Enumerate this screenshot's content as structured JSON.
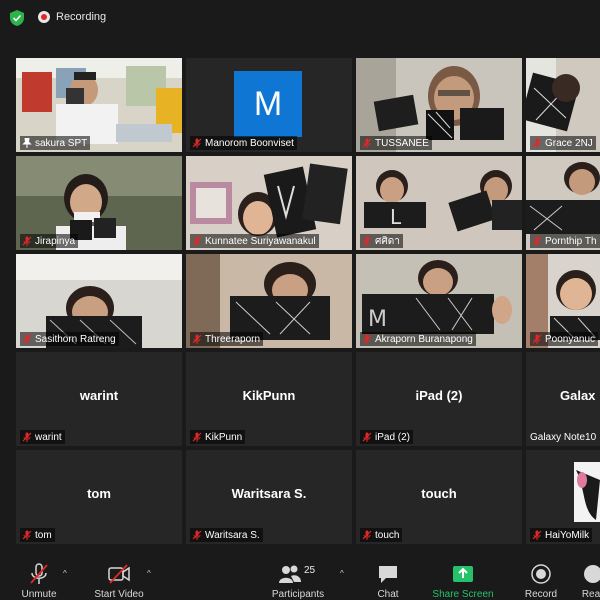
{
  "top": {
    "recording_label": "Recording"
  },
  "tiles": [
    {
      "name": "sakura SPT",
      "type": "video"
    },
    {
      "name": "Manorom Boonviset",
      "type": "avatar",
      "initial": "M"
    },
    {
      "name": "TUSSANEE",
      "type": "video"
    },
    {
      "name": "Grace 2NJ",
      "type": "video"
    },
    {
      "name": "Jirapinya",
      "type": "video"
    },
    {
      "name": "Kunnatee Suriyawanakul",
      "type": "video"
    },
    {
      "name": "ศศิดา",
      "type": "video"
    },
    {
      "name": "Pornthip Th",
      "type": "video"
    },
    {
      "name": "Sasithorn Ratreng",
      "type": "video"
    },
    {
      "name": "Threeraporn",
      "type": "video"
    },
    {
      "name": "Akraporn Buranapong",
      "type": "video"
    },
    {
      "name": "Poonyanuc",
      "type": "video"
    },
    {
      "name": "warint",
      "display": "warint",
      "type": "name"
    },
    {
      "name": "KikPunn",
      "display": "KikPunn",
      "type": "name"
    },
    {
      "name": "iPad (2)",
      "display": "iPad (2)",
      "type": "name"
    },
    {
      "name": "Galaxy Note10",
      "display": "Galax",
      "type": "name"
    },
    {
      "name": "tom",
      "display": "tom",
      "type": "name"
    },
    {
      "name": "Waritsara S.",
      "display": "Waritsara S.",
      "type": "name"
    },
    {
      "name": "touch",
      "display": "touch",
      "type": "name"
    },
    {
      "name": "HaiYoMilk",
      "type": "video"
    }
  ],
  "toolbar": {
    "unmute": "Unmute",
    "start_video": "Start Video",
    "participants": "Participants",
    "participants_count": "25",
    "chat": "Chat",
    "share_screen": "Share Screen",
    "record": "Record",
    "reactions": "Rea"
  },
  "colors": {
    "accent_active": "#c6e33a",
    "share_green": "#25c26b",
    "muted_red": "#e02828",
    "avatar_blue": "#0f76d4"
  }
}
